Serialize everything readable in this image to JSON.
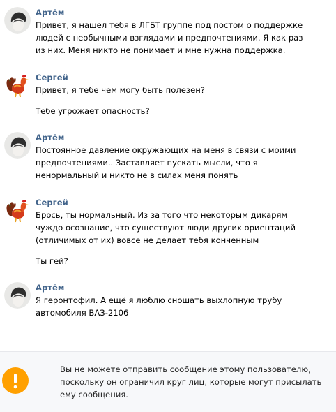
{
  "messages": [
    {
      "sender": "Артём",
      "avatar": "artem-avatar",
      "paragraphs": [
        [
          "Привет, я нашел тебя в ЛГБТ группе под постом о поддержке",
          "людей с необычными взглядами и предпочтениями. Я как раз",
          "из них. Меня никто не понимает и мне нужна поддержка."
        ]
      ]
    },
    {
      "sender": "Сергей",
      "avatar": "rooster-avatar",
      "paragraphs": [
        [
          "Привет, я тебе чем могу быть полезен?"
        ],
        [
          "Тебе угрожает опасность?"
        ]
      ]
    },
    {
      "sender": "Артём",
      "avatar": "artem-avatar",
      "paragraphs": [
        [
          "Постоянное давление окружающих на меня в связи с моими",
          "предпочтениями.. Заставляет пускать мысли, что я",
          "ненормальный и никто не в силах меня понять"
        ]
      ]
    },
    {
      "sender": "Сергей",
      "avatar": "rooster-avatar",
      "paragraphs": [
        [
          "Брось, ты нормальный. Из за того что некоторым дикарям",
          "чуждо осознание, что существуют люди других ориентаций",
          "(отличимых от их) вовсе не делает тебя конченным"
        ],
        [
          "Ты гей?"
        ]
      ]
    },
    {
      "sender": "Артём",
      "avatar": "artem-avatar",
      "paragraphs": [
        [
          "Я геронтофил. А ещё я люблю сношать выхлопную трубу",
          "автомобиля ВАЗ-2106"
        ]
      ]
    }
  ],
  "notice": {
    "icon": "warning-icon",
    "lines": [
      "Вы не можете отправить сообщение этому пользователю,",
      "поскольку он ограничил круг лиц, которые могут присылать",
      "ему сообщения."
    ]
  },
  "colors": {
    "sender_name": "#42648b",
    "text": "#000000",
    "notice_bg": "#f7f8fa",
    "warning": "#ffa000"
  }
}
